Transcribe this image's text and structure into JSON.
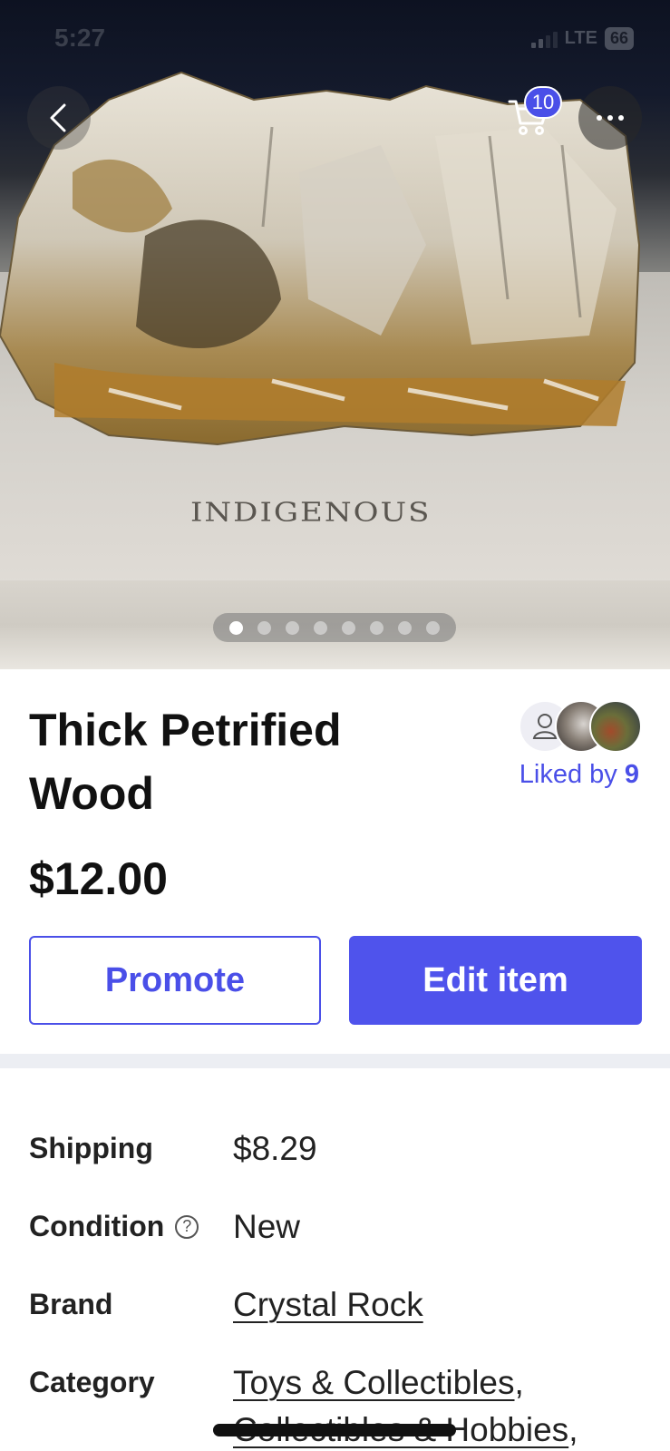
{
  "status_bar": {
    "time": "5:27",
    "network": "LTE",
    "battery": "66"
  },
  "product_photo": {
    "engraving_text": "INDIGENOUS",
    "photo_count": 8,
    "active_photo_index": 0
  },
  "header": {
    "cart_count": "10"
  },
  "product": {
    "title": "Thick Petrified Wood",
    "price": "$12.00",
    "liked_by_label": "Liked by",
    "liked_by_count": "9"
  },
  "actions": {
    "promote_label": "Promote",
    "edit_label": "Edit item"
  },
  "details": {
    "shipping_label": "Shipping",
    "shipping_value": "$8.29",
    "condition_label": "Condition",
    "condition_value": "New",
    "brand_label": "Brand",
    "brand_value": "Crystal Rock",
    "category_label": "Category",
    "category_value_1": "Toys & Collectibles",
    "category_sep_1": ",",
    "category_value_2": "Collectibles & Hobbies",
    "category_sep_2": ","
  },
  "colors": {
    "accent": "#4f53ec",
    "divider": "#eceef3",
    "text": "#222222"
  }
}
